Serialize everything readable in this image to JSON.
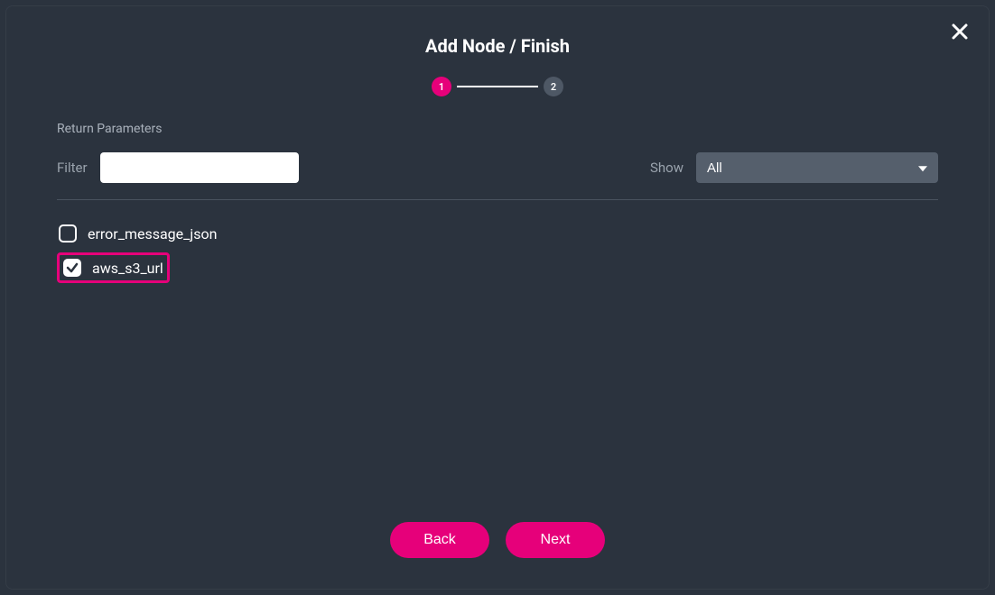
{
  "header": {
    "title": "Add Node / Finish"
  },
  "stepper": {
    "step1": "1",
    "step2": "2"
  },
  "section": {
    "return_params_label": "Return Parameters"
  },
  "filter": {
    "label": "Filter",
    "value": ""
  },
  "show": {
    "label": "Show",
    "selected": "All"
  },
  "params": [
    {
      "label": "error_message_json",
      "checked": false,
      "highlight": false
    },
    {
      "label": "aws_s3_url",
      "checked": true,
      "highlight": true
    }
  ],
  "footer": {
    "back_label": "Back",
    "next_label": "Next"
  }
}
